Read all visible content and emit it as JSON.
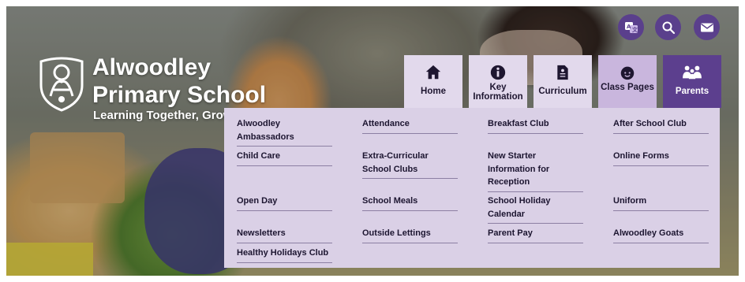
{
  "school": {
    "name_line1": "Alwoodley",
    "name_line2": "Primary School",
    "tagline": "Learning Together, Growing Together"
  },
  "utility": {
    "translate_icon": "translate-icon",
    "search_icon": "search-icon",
    "mail_icon": "mail-icon"
  },
  "nav": {
    "home": "Home",
    "key_information": "Key Information",
    "curriculum": "Curriculum",
    "class_pages": "Class Pages",
    "parents": "Parents"
  },
  "menu": [
    [
      "Alwoodley Ambassadors",
      "Attendance",
      "Breakfast Club",
      "After School Club"
    ],
    [
      "Child Care",
      "Extra-Curricular School Clubs",
      "New Starter Information for Reception",
      "Online Forms"
    ],
    [
      "Open Day",
      "School Meals",
      "School Holiday Calendar",
      "Uniform"
    ],
    [
      "Newsletters",
      "Outside Lettings",
      "Parent Pay",
      "Alwoodley Goats"
    ],
    [
      "Healthy Holidays Club"
    ]
  ],
  "colors": {
    "accent": "#5c3f8e",
    "tab_bg": "#e2d9ec",
    "tab_active": "#c9b6dd",
    "panel_bg": "#dad0e6"
  }
}
